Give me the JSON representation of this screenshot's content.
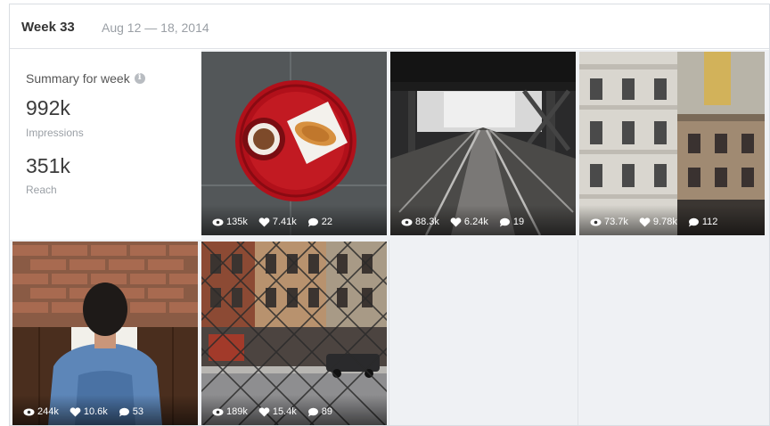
{
  "header": {
    "week_label": "Week 33",
    "date_range": "Aug 12 — 18, 2014"
  },
  "summary": {
    "title": "Summary for week",
    "impressions_value": "992k",
    "impressions_label": "Impressions",
    "reach_value": "351k",
    "reach_label": "Reach"
  },
  "posts": [
    {
      "subject": "coffee and croissant on red table",
      "views": "135k",
      "likes": "7.41k",
      "comments": "22"
    },
    {
      "subject": "railway tracks under bridge",
      "views": "88.3k",
      "likes": "6.24k",
      "comments": "19"
    },
    {
      "subject": "city buildings facade",
      "views": "73.7k",
      "likes": "9.78k",
      "comments": "112"
    },
    {
      "subject": "man reading against brick wall",
      "views": "244k",
      "likes": "10.6k",
      "comments": "53"
    },
    {
      "subject": "street through chain-link fence",
      "views": "189k",
      "likes": "15.4k",
      "comments": "89"
    }
  ],
  "icons": {
    "views": "eye-icon",
    "likes": "heart-icon",
    "comments": "comment-icon",
    "info": "info-icon"
  },
  "colors": {
    "grid_background": "#eff1f4",
    "border": "#dfe2e6",
    "muted_text": "#9ba0a6"
  }
}
